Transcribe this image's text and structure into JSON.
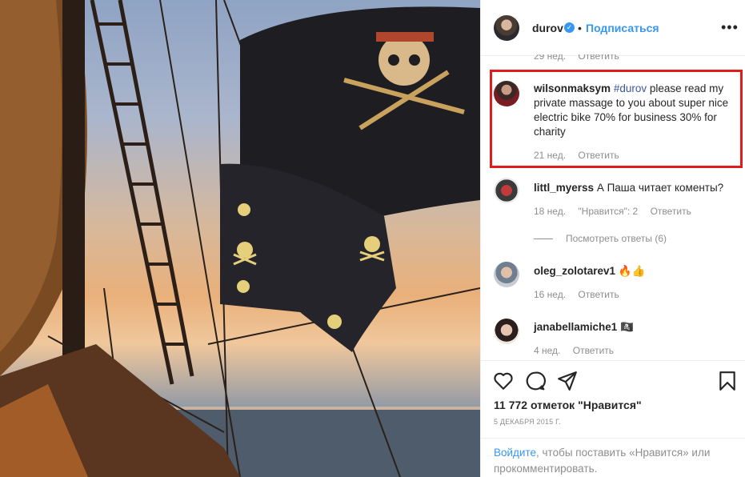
{
  "post_author": {
    "username": "durov",
    "follow_label": "Подписаться",
    "dot": "•"
  },
  "ghost_row": {
    "age": "29 нед.",
    "reply": "Ответить"
  },
  "comments": [
    {
      "username": "wilsonmaksym",
      "hashtag": "#durov",
      "text": " please read my private massage to you about super nice electric bike 70% for business 30% for charity",
      "age": "21 нед.",
      "reply": "Ответить"
    },
    {
      "username": "littl_myerss",
      "text": "А Паша читает коменты?",
      "age": "18 нед.",
      "likes": "\"Нравится\": 2",
      "reply": "Ответить",
      "view_replies": "Посмотреть ответы (6)"
    },
    {
      "username": "oleg_zolotarev1",
      "text": "🔥👍",
      "age": "16 нед.",
      "reply": "Ответить"
    },
    {
      "username": "janabellamiche1",
      "text": "🏴‍☠️",
      "age": "4 нед.",
      "reply": "Ответить"
    }
  ],
  "actions": {
    "likes_count": "11 772 отметок \"Нравится\"",
    "date": "5 ДЕКАБРЯ 2015 Г.",
    "login_link": "Войдите",
    "login_text": ", чтобы поставить «Нравится» или прокомментировать."
  },
  "icons": [
    "more-icon",
    "verified-icon",
    "heart-icon",
    "comment-icon",
    "share-icon",
    "bookmark-icon"
  ],
  "colors": {
    "accent": "#3897f0",
    "highlight": "#e11c1c",
    "muted": "#8e8e8e",
    "text": "#262626"
  }
}
